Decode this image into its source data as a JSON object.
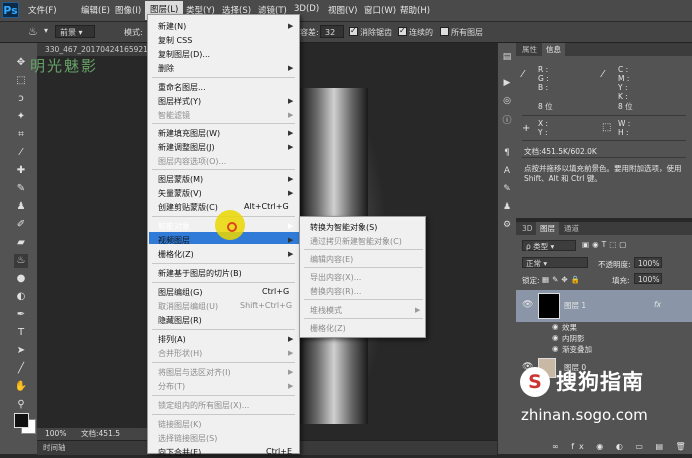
{
  "menubar": {
    "logo": "Ps",
    "items": [
      "文件(F)",
      "编辑(E)",
      "图像(I)",
      "图层(L)",
      "类型(Y)",
      "选择(S)",
      "滤镜(T)",
      "3D(D)",
      "视图(V)",
      "窗口(W)",
      "帮助(H)"
    ],
    "active_index": 3
  },
  "options": {
    "mode_select": "前景",
    "mode_label": "模式:",
    "tolerance_label": "容差:",
    "tolerance_value": "32",
    "antialias_label": "消除锯齿",
    "contiguous_label": "连续的",
    "all_layers_label": "所有图层"
  },
  "document": {
    "tab_title": "330_467_20170424165921-",
    "watermark": "明光魅影",
    "zoom": "100%",
    "doc_info": "文档:451.5"
  },
  "timeline_tab": "时间轴",
  "layer_menu": {
    "items": [
      {
        "label": "新建(N)",
        "arrow": true,
        "disabled": false
      },
      {
        "label": "复制 CSS",
        "disabled": false
      },
      {
        "label": "复制图层(D)...",
        "disabled": false
      },
      {
        "label": "删除",
        "arrow": true,
        "disabled": false
      },
      {
        "label": "重命名图层...",
        "disabled": false
      },
      {
        "label": "图层样式(Y)",
        "arrow": true,
        "disabled": false
      },
      {
        "label": "智能滤镜",
        "arrow": true,
        "disabled": true
      },
      {
        "label": "新建填充图层(W)",
        "arrow": true,
        "disabled": false
      },
      {
        "label": "新建调整图层(J)",
        "arrow": true,
        "disabled": false
      },
      {
        "label": "图层内容选项(O)...",
        "disabled": true
      },
      {
        "label": "图层蒙版(M)",
        "arrow": true,
        "disabled": false
      },
      {
        "label": "矢量蒙版(V)",
        "arrow": true,
        "disabled": false
      },
      {
        "label": "创建剪贴蒙版(C)",
        "shortcut": "Alt+Ctrl+G",
        "disabled": false
      },
      {
        "label": "智能对象",
        "arrow": true,
        "disabled": false,
        "highlighted": true
      },
      {
        "label": "视频图层",
        "arrow": true,
        "disabled": false
      },
      {
        "label": "栅格化(Z)",
        "arrow": true,
        "disabled": false
      },
      {
        "label": "新建基于图层的切片(B)",
        "disabled": false
      },
      {
        "label": "图层编组(G)",
        "shortcut": "Ctrl+G",
        "disabled": false
      },
      {
        "label": "取消图层编组(U)",
        "shortcut": "Shift+Ctrl+G",
        "disabled": true
      },
      {
        "label": "隐藏图层(R)",
        "disabled": false
      },
      {
        "label": "排列(A)",
        "arrow": true,
        "disabled": false
      },
      {
        "label": "合并形状(H)",
        "arrow": true,
        "disabled": true
      },
      {
        "label": "将图层与选区对齐(I)",
        "arrow": true,
        "disabled": true
      },
      {
        "label": "分布(T)",
        "arrow": true,
        "disabled": true
      },
      {
        "label": "锁定组内的所有图层(X)...",
        "disabled": true
      },
      {
        "label": "链接图层(K)",
        "disabled": true
      },
      {
        "label": "选择链接图层(S)",
        "disabled": true
      },
      {
        "label": "向下合并(E)",
        "shortcut": "Ctrl+E",
        "disabled": false
      }
    ]
  },
  "smart_object_submenu": {
    "items": [
      {
        "label": "转换为智能对象(S)",
        "disabled": false
      },
      {
        "label": "通过拷贝新建智能对象(C)",
        "disabled": true
      },
      {
        "label": "编辑内容(E)",
        "disabled": true
      },
      {
        "label": "导出内容(X)...",
        "disabled": true
      },
      {
        "label": "替换内容(R)...",
        "disabled": true
      },
      {
        "label": "堆栈模式",
        "arrow": true,
        "disabled": true
      },
      {
        "label": "栅格化(Z)",
        "disabled": true
      }
    ]
  },
  "info_panel": {
    "tabs": [
      "属性",
      "信息"
    ],
    "active_tab": 1,
    "rgb": [
      "R :",
      "G :",
      "B :"
    ],
    "cmyk": [
      "C :",
      "M :",
      "Y :",
      "K :"
    ],
    "bit_left": "8 位",
    "bit_right": "8 位",
    "xy": [
      "X :",
      "Y :"
    ],
    "wh": [
      "W :",
      "H :"
    ],
    "doc_size": "文档:451.5K/602.0K",
    "hint": "点按并拖移以填充前景色。要用附加选项，使用 Shift、Alt 和 Ctrl 键。"
  },
  "layers_panel": {
    "tabs": [
      "3D",
      "图层",
      "通道"
    ],
    "active_tab": 1,
    "filter": "类型",
    "blend_mode": "正常",
    "opacity_label": "不透明度:",
    "opacity_value": "100%",
    "lock_label": "锁定:",
    "fill_label": "填充:",
    "fill_value": "100%",
    "layer1_name": "图层 1",
    "fx": "fx",
    "effects_label": "效果",
    "effect1": "内阴影",
    "effect2": "渐变叠加",
    "layer0_name": "图层 0"
  },
  "watermark_sogou": {
    "title": "搜狗指南",
    "url": "zhinan.sogo.com"
  },
  "colors": {
    "highlight": "#2f7bd7",
    "menu_bg": "#f0f0f0",
    "panel_bg": "#535353",
    "cursor_ring": "#ebd700"
  }
}
